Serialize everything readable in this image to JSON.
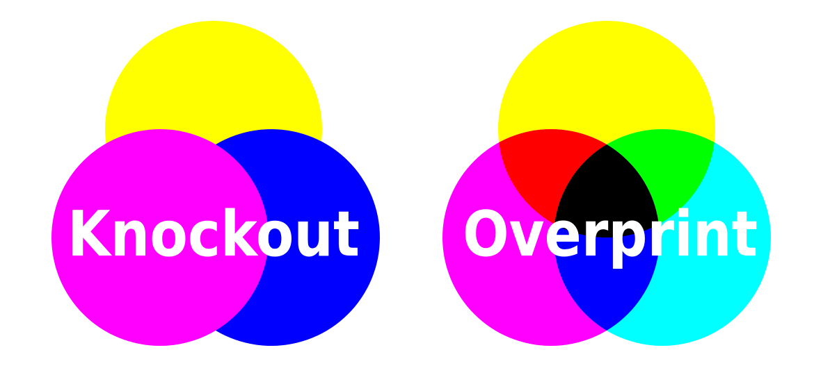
{
  "colors": {
    "background": "#ffffff",
    "yellow": "#ffff00",
    "magenta": "#ff00ff",
    "blue": "#0000ff",
    "cyan": "#00ffff",
    "red": "#ff0000",
    "green": "#00ff00",
    "black": "#000000",
    "label": "#ffffff"
  },
  "knockout": {
    "label": "Knockout"
  },
  "overprint": {
    "label": "Overprint"
  }
}
